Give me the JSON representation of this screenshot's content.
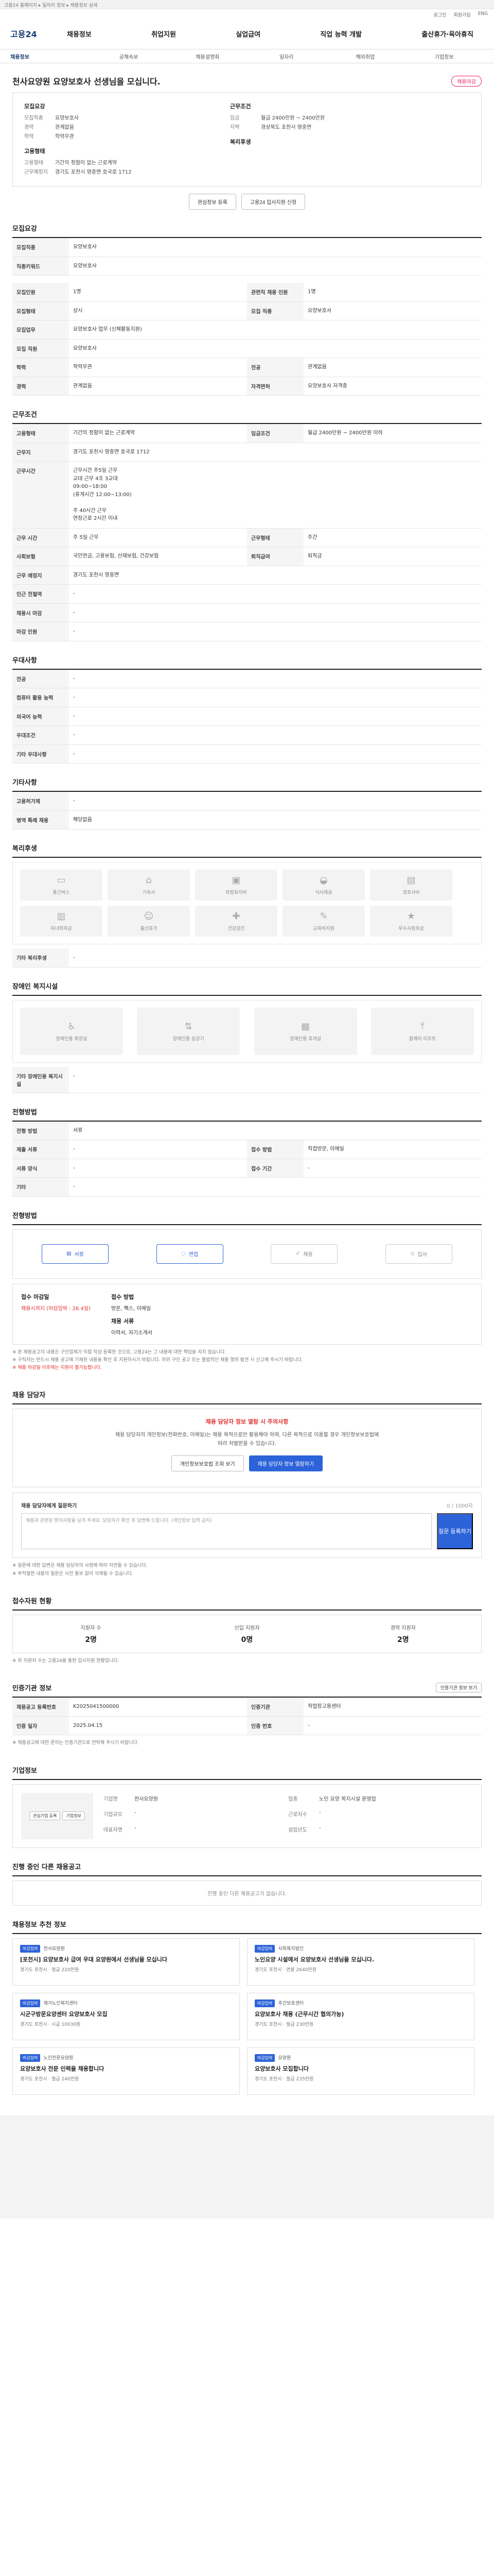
{
  "topbar": "고용24 홈페이지 ▸ 일자리 정보 ▸ 채용정보 상세",
  "util": [
    "로그인",
    "회원가입",
    "ENG"
  ],
  "logo": "고용24",
  "gnb": [
    "채용정보",
    "취업지원",
    "실업급여",
    "직업 능력 개발",
    "출산휴가·육아휴직"
  ],
  "sub": [
    "채용정보",
    "공채속보",
    "채용설명회",
    "일자리",
    "해외취업",
    "기업정보"
  ],
  "job": {
    "title": "천사요양원 요양보호사 선생님을 모십니다.",
    "badge": "채용마감",
    "l": {
      "label": "모집요강",
      "rows": [
        [
          "모집직종",
          "요양보호사"
        ],
        [
          "경력",
          "관계없음"
        ],
        [
          "학력",
          "학력무관"
        ]
      ],
      "label2": "고용형태",
      "rows2": [
        [
          "고용형태",
          "기간의 정함이 없는 근로계약"
        ],
        [
          "근무예정지",
          "경기도 포천시 영중면 호국로 1712"
        ]
      ]
    },
    "r": {
      "label": "근무조건",
      "rows": [
        [
          "임금",
          "월급 2400만원 ~ 2400만원"
        ],
        [
          "지역",
          "경상북도 포천시 영중면"
        ]
      ],
      "label2": "복리후생",
      "rows2": []
    }
  },
  "actions": {
    "scrap": "관심정보 등록",
    "apply": "고용24 입사지원 신청"
  },
  "sec": {
    "jobinfo": "모집요강",
    "cond": "근무조건",
    "pref": "우대사항",
    "other": "기타사항",
    "welfare": "복리후생",
    "disab": "장애인 복지시설",
    "method": "전형방법",
    "contact": "채용 담당자",
    "apply": "접수자원 현황",
    "register": "인증기관 정보",
    "company": "기업정보",
    "similar": "진행 중인 다른 채용공고",
    "rec": "채용정보 추천 정보"
  },
  "jobinfo": [
    [
      "모집직종",
      "요양보호사"
    ],
    [
      "직종키워드",
      "요양보호사"
    ]
  ],
  "jobinfo2": [
    [
      "모집인원",
      "1명"
    ],
    [
      "관련직 채용 인원",
      "1명"
    ],
    [
      "모집형태",
      "상시"
    ],
    [
      "모집 직종",
      "요양보호사"
    ],
    [
      "모집업무",
      "요양보호사 업무 (신체활동지원)"
    ],
    [
      "모집 직원",
      "요양보호사"
    ],
    [
      "학력",
      "학력무관"
    ],
    [
      "전공",
      "관계없음"
    ],
    [
      "경력",
      "관계없음"
    ],
    [
      "자격면허",
      "요양보호사 자격증"
    ]
  ],
  "cond": [
    [
      "고용형태",
      "기간의 정함이 없는 근로계약"
    ],
    [
      "임금조건",
      "월급 2400만원 ~ 2400만원 이하"
    ],
    [
      "근무지",
      "경기도 포천시 영중면 호국로 1712"
    ]
  ],
  "hours": "근무시간 주5일 근무\n교대 근무 4조 3교대\n09:00~18:00\n(휴게시간 12:00~13:00)\n\n주 40시간 근무\n연장근로 2시간 이내",
  "cond2": [
    [
      "근무 시간",
      "주 5일 근무"
    ],
    [
      "근무형태",
      "주간"
    ],
    [
      "사회보험",
      "국민연금, 고용보험, 산재보험, 건강보험"
    ],
    [
      "퇴직급여",
      "퇴직금"
    ]
  ],
  "cond3": [
    [
      "근무 예정지",
      "경기도 포천시 영중면"
    ],
    [
      "인근 전철역",
      "-"
    ],
    [
      "채용시 마감",
      "-"
    ],
    [
      "마감 인원",
      "-"
    ]
  ],
  "pref": [
    [
      "전공",
      "-"
    ],
    [
      "컴퓨터 활용 능력",
      "-"
    ],
    [
      "외국어 능력",
      "-"
    ],
    [
      "우대조건",
      "-"
    ],
    [
      "기타 우대사항",
      "-"
    ]
  ],
  "other": [
    [
      "고용허가제",
      "-"
    ],
    [
      "병역 특례 채용",
      "해당없음"
    ]
  ],
  "welfare_icons": [
    "통근버스",
    "기숙사",
    "차량유지비",
    "식사제공",
    "경조사비",
    "자녀학자금",
    "출산휴가",
    "건강검진",
    "교육비지원",
    "우수사원포상"
  ],
  "welfare_note": "기타 복리후생",
  "disab_icons": [
    "장애인용 화장실",
    "장애인용 승강기",
    "장애인용 휴게실",
    "휠체어 리프트"
  ],
  "disab_note": "기타 장애인용 복지시설",
  "method": [
    [
      "전형 방법",
      "서류"
    ],
    [
      "제출 서류",
      "-"
    ],
    [
      "접수 방법",
      "직접방문, 이메일"
    ],
    [
      "서류 양식",
      "-"
    ],
    [
      "접수 기간",
      "-"
    ],
    [
      "기타",
      "-"
    ]
  ],
  "steps": [
    "서류",
    "면접",
    "채용",
    "입사"
  ],
  "contact_block": {
    "t1": "접수 마감일",
    "v1": "채용시까지 (마감임박 : 26.4일)",
    "t2": "접수 방법",
    "v2": "방문, 팩스, 이메일",
    "t3": "채용 서류",
    "v3": "이력서, 자기소개서"
  },
  "notes": [
    "※ 본 채용공고의 내용은 구인업체가 직접 작성·등록한 것으로, 고용24는 그 내용에 대한 책임을 지지 않습니다.",
    "※ 구직자는 반드시 채용 공고에 기재된 내용을 확인 후 지원하시기 바랍니다. 허위 구인 공고 또는 불법적인 채용 행위 발견 시 신고해 주시기 바랍니다.",
    "※ 채용 마감일 이후에는 지원이 불가능합니다."
  ],
  "contact": {
    "title": "채용 담당자 정보 열람 시 주의사항",
    "body": "채용 담당자의 개인정보(전화번호, 이메일)는 채용 목적으로만 활용해야 하며, 다른 목적으로 이용할 경우 개인정보보호법에 따라 처벌받을 수 있습니다.",
    "b1": "개인정보보호법 조회 보기",
    "b2": "채용 담당자 정보 열람하기"
  },
  "qna": {
    "label": "채용 담당자에게 질문하기",
    "help": "채용과 관련된 문의사항을 남겨 주세요. 담당자가 확인 후 답변해 드립니다. (개인정보 입력 금지)",
    "count": "0 / 1000자",
    "submit": "질문 등록하기"
  },
  "qna_notes": [
    "※ 질문에 대한 답변은 채용 담당자의 사정에 따라 지연될 수 있습니다.",
    "※ 부적절한 내용의 질문은 사전 통보 없이 삭제될 수 있습니다."
  ],
  "apply": [
    [
      "지원자 수",
      "2명"
    ],
    [
      "신입 지원자",
      "0명"
    ],
    [
      "경력 지원자",
      "2명"
    ]
  ],
  "apply_note": "※ 위 지원자 수는 고용24를 통한 입사지원 현황입니다.",
  "register": [
    [
      "채용공고 등록번호",
      "K2025041500000"
    ],
    [
      "인증기관",
      "작업장고용센터"
    ],
    [
      "인증 일자",
      "2025.04.15"
    ],
    [
      "인증 번호",
      "-"
    ]
  ],
  "register_btn": "인증기관 정보 보기",
  "register_note": "※ 채용공고에 대한 문의는 인증기관으로 연락해 주시기 바랍니다.",
  "company": [
    [
      "기업명",
      "천사요양원"
    ],
    [
      "업종",
      "노인 요양 복지시설 운영업"
    ],
    [
      "기업규모",
      "-"
    ],
    [
      "근로자수",
      "-"
    ],
    [
      "대표자명",
      "-"
    ],
    [
      "설립년도",
      "-"
    ]
  ],
  "company_btns": [
    "관심기업 등록",
    "기업정보"
  ],
  "similar_empty": "진행 중인 다른 채용공고가 없습니다.",
  "rec": [
    {
      "tag": "마감임박",
      "co": "천사요양원",
      "t": "[포천시] 요양보호사 급여 우대 요양원에서 선생님을 모십니다",
      "m": "경기도 포천시 · 월급 220만원"
    },
    {
      "tag": "마감임박",
      "co": "사회복지법인",
      "t": "노인요양 시설에서 요양보호사 선생님을 모십니다.",
      "m": "경기도 포천시 · 연봉 2640만원"
    },
    {
      "tag": "마감임박",
      "co": "재가노인복지센터",
      "t": "시군구방문요양센터 요양보호사 모집",
      "m": "경기도 포천시 · 시급 10030원"
    },
    {
      "tag": "마감임박",
      "co": "주간보호센터",
      "t": "요양보호사 채용 (근무시간 협의가능)",
      "m": "경기도 포천시 · 월급 230만원"
    },
    {
      "tag": "마감임박",
      "co": "노인전문요양원",
      "t": "요양보호사 전문 인력을 채용합니다",
      "m": "경기도 포천시 · 월급 240만원"
    },
    {
      "tag": "마감임박",
      "co": "요양원",
      "t": "요양보호사 모집합니다",
      "m": "경기도 포천시 · 월급 235만원"
    }
  ]
}
